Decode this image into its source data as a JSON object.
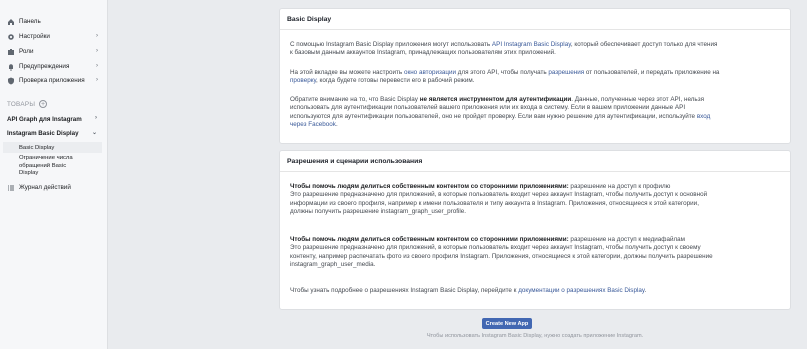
{
  "sidebar": {
    "items": [
      {
        "label": "Панель",
        "icon": "home-icon"
      },
      {
        "label": "Настройки",
        "icon": "gear-icon"
      },
      {
        "label": "Роли",
        "icon": "roles-icon"
      },
      {
        "label": "Предупреждения",
        "icon": "bell-icon"
      },
      {
        "label": "Проверка приложения",
        "icon": "shield-icon"
      }
    ],
    "products_title": "ТОВАРЫ",
    "products": [
      {
        "label": "API Graph для Instagram"
      },
      {
        "label": "Instagram Basic Display"
      }
    ],
    "sub_items": [
      {
        "label": "Basic Display"
      },
      {
        "label": "Ограничение числа обращений Basic Display"
      }
    ],
    "activity_log": "Журнал действий"
  },
  "card1": {
    "title": "Basic Display",
    "p1_a": "С помощью Instagram Basic Display приложения могут использовать ",
    "p1_link": "API Instagram Basic Display",
    "p1_b": ", который обеспечивает доступ только для чтения к базовым данным аккаунтов Instagram, принадлежащих пользователям этих приложений.",
    "p2_a": "На этой вкладке вы можете настроить ",
    "p2_link1": "окно авторизации",
    "p2_b": " для этого API, чтобы получать ",
    "p2_link2": "разрешения",
    "p2_c": " от пользователей, и передать приложение на ",
    "p2_link3": "проверку",
    "p2_d": ", когда будете готовы перевести его в рабочий режим.",
    "p3_a": "Обратите внимание на то, что Basic Display ",
    "p3_bold": "не является инструментом для аутентификации",
    "p3_b": ". Данные, полученные через этот API, нельзя использовать для аутентификации пользователей вашего приложения или их входа в систему. Если в вашем приложении данные API используются для аутентификации пользователей, оно не пройдет проверку. Если вам нужно решение для аутентификации, используйте ",
    "p3_link": "вход через Facebook",
    "p3_c": "."
  },
  "card2": {
    "title": "Разрешения и сценарии использования",
    "b1_bold": "Чтобы помочь людям делиться собственным контентом со сторонними приложениями:",
    "b1_after": " разрешение на доступ к профилю",
    "b1_text": "Это разрешение предназначено для приложений, в которые пользователь входит через аккаунт Instagram, чтобы получить доступ к основной информации из своего профиля, например к имени пользователя и типу аккаунта в Instagram. Приложения, относящиеся к этой категории, должны получить разрешение instagram_graph_user_profile.",
    "b2_bold": "Чтобы помочь людям делиться собственным контентом со сторонними приложениями:",
    "b2_after": " разрешение на доступ к медиафайлам",
    "b2_text": "Это разрешение предназначено для приложений, в которые пользователь входит через аккаунт Instagram, чтобы получить доступ к своему контенту, например распечатать фото из своего профиля Instagram. Приложения, относящиеся к этой категории, должны получить разрешение instagram_graph_user_media.",
    "b3_a": "Чтобы узнать подробнее о разрешениях Instagram Basic Display, перейдите к ",
    "b3_link": "документации о разрешениях Basic Display",
    "b3_b": "."
  },
  "footer": {
    "button": "Create New App",
    "note": "Чтобы использовать Instagram Basic Display, нужно создать приложение Instagram."
  }
}
